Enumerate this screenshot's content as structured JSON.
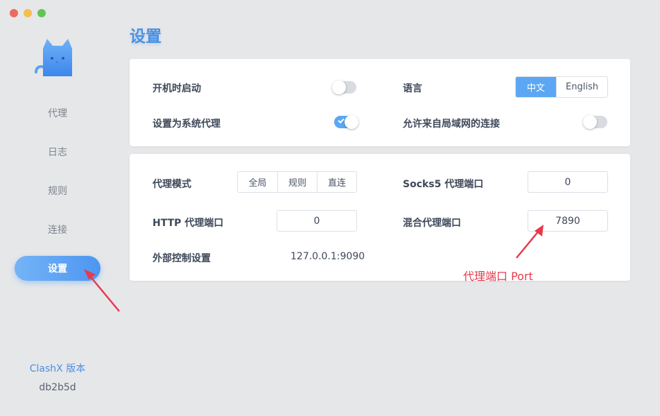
{
  "window": {
    "controls": [
      "close",
      "minimize",
      "maximize"
    ]
  },
  "sidebar": {
    "logo_icon": "cat-icon",
    "items": [
      {
        "label": "代理",
        "active": false
      },
      {
        "label": "日志",
        "active": false
      },
      {
        "label": "规则",
        "active": false
      },
      {
        "label": "连接",
        "active": false
      },
      {
        "label": "设置",
        "active": true
      }
    ],
    "version_label": "ClashX 版本",
    "version_value": "db2b5d"
  },
  "page": {
    "title": "设置"
  },
  "general": {
    "launch_at_login": {
      "label": "开机时启动",
      "enabled": false
    },
    "system_proxy": {
      "label": "设置为系统代理",
      "enabled": true
    },
    "language": {
      "label": "语言",
      "options": [
        "中文",
        "English"
      ],
      "selected": "中文"
    },
    "allow_lan": {
      "label": "允许来自局域网的连接",
      "enabled": false
    }
  },
  "proxy": {
    "mode": {
      "label": "代理模式",
      "options": [
        "全局",
        "规则",
        "直连"
      ],
      "selected": ""
    },
    "socks5_port": {
      "label": "Socks5 代理端口",
      "value": "0"
    },
    "http_port": {
      "label": "HTTP 代理端口",
      "value": "0"
    },
    "mixed_port": {
      "label": "混合代理端口",
      "value": "7890"
    },
    "external_controller": {
      "label": "外部控制设置",
      "value": "127.0.0.1:9090"
    }
  },
  "annotations": {
    "port_note": "代理端口 Port",
    "arrow_color": "#e8394b"
  },
  "colors": {
    "accent": "#4a90e2",
    "toggle_on": "#5ca7f3",
    "annotation": "#e8394b"
  }
}
